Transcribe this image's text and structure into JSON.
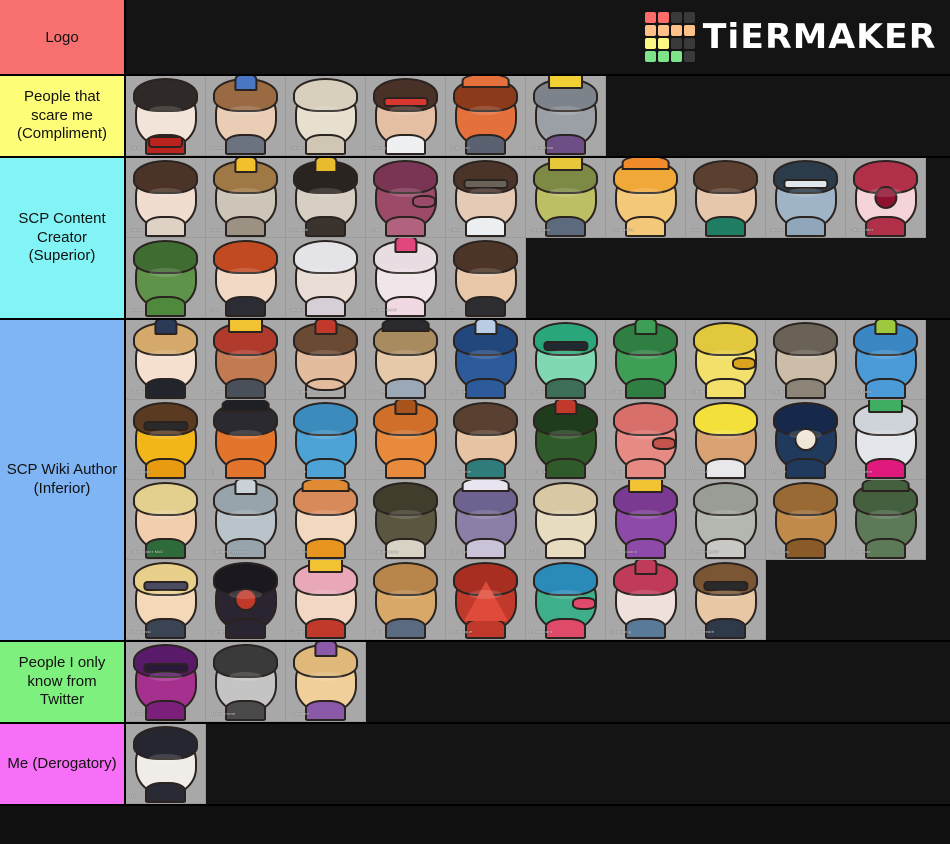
{
  "header": {
    "logo_label": "Logo",
    "brand_name": "TiERMAKER",
    "brand_colors": {
      "red": "#ff6b6b",
      "orange": "#ffc089",
      "yellow": "#fbf783",
      "green": "#7fe38a",
      "empty": "#3a3a3a"
    },
    "logo_grid": [
      [
        "red",
        "red",
        "empty",
        "empty"
      ],
      [
        "orange",
        "orange",
        "orange",
        "orange"
      ],
      [
        "yellow",
        "yellow",
        "empty",
        "empty"
      ],
      [
        "green",
        "green",
        "green",
        "empty"
      ]
    ]
  },
  "tiers": [
    {
      "label": "People that scare me (Compliment)",
      "color": "#fdfd77",
      "rows": [
        [
          {
            "name": "pale-clown-face-avatar",
            "wm": "Asriel",
            "skin": "#f2e4d9",
            "hair": "#2f2a28",
            "acc": "#b9241f",
            "body": "#b9241f",
            "acc_kind": "bowtie"
          },
          {
            "name": "curly-hair-goggles-avatar",
            "wm": "Anaxes",
            "skin": "#e9cdb4",
            "hair": "#9a6b42",
            "acc": "#4a77c4",
            "body": "#6b7280",
            "acc_kind": "goggles"
          },
          {
            "name": "skull-avatar",
            "wm": "Smapti",
            "skin": "#e8e0cf",
            "hair": "#d8cfbc",
            "acc": "#e8e0cf",
            "body": "#cfc6b3",
            "acc_kind": "none"
          },
          {
            "name": "red-glasses-man-avatar",
            "wm": "Tanhony",
            "skin": "#e5bfa3",
            "hair": "#4a3127",
            "acc": "#d8372f",
            "body": "#eef0f2",
            "acc_kind": "glasses"
          },
          {
            "name": "red-demon-avatar",
            "wm": "Ogre Lord",
            "skin": "#e4703c",
            "hair": "#8c3a1c",
            "acc": "#e4703c",
            "body": "#5a6170",
            "acc_kind": "horns"
          },
          {
            "name": "yellow-cap-man-avatar",
            "wm": "Grand Rose",
            "skin": "#9aa0a6",
            "hair": "#7d838a",
            "acc": "#f3cf36",
            "body": "#6e4e86",
            "acc_kind": "cap"
          }
        ]
      ]
    },
    {
      "label": "SCP Content Creator (Superior)",
      "color": "#82f4f6",
      "rows": [
        [
          {
            "name": "long-dark-hair-avatar",
            "wm": "Wookily",
            "skin": "#f0ddd0",
            "hair": "#4b3427",
            "acc": "#4b3427",
            "body": "#ded2c4",
            "acc_kind": "none"
          },
          {
            "name": "yellow-flower-hair-avatar",
            "wm": "Cillan",
            "skin": "#cdc6b8",
            "hair": "#a07845",
            "acc": "#f2c02d",
            "body": "#9c9284",
            "acc_kind": "flower"
          },
          {
            "name": "gold-mask-avatar",
            "wm": "Decibelle",
            "skin": "#d8cfc4",
            "hair": "#2a2420",
            "acc": "#e7bb2c",
            "body": "#3a332e",
            "acc_kind": "flower"
          },
          {
            "name": "purple-dragon-avatar",
            "wm": "Grim",
            "skin": "#9c4a6a",
            "hair": "#7b3554",
            "acc": "#9c4a6a",
            "body": "#b0627f",
            "acc_kind": "snout"
          },
          {
            "name": "glasses-lab-coat-avatar",
            "wm": "Elena",
            "skin": "#e5cbb6",
            "hair": "#4a342a",
            "acc": "#6a6258",
            "body": "#eceff2",
            "acc_kind": "glasses"
          },
          {
            "name": "crowned-frog-avatar",
            "wm": "Frogdonia",
            "skin": "#bcbf64",
            "hair": "#7d8a45",
            "acc": "#e7c83a",
            "body": "#5d6a7e",
            "acc_kind": "crown"
          },
          {
            "name": "orange-rabbit-avatar",
            "wm": "Lil Sunshine",
            "skin": "#f3c878",
            "hair": "#f0a838",
            "acc": "#f08a2a",
            "body": "#f3c878",
            "acc_kind": "ears"
          },
          {
            "name": "brown-hair-green-shirt-avatar",
            "wm": "Locky",
            "skin": "#e7c7ac",
            "hair": "#5b4030",
            "acc": "#5b4030",
            "body": "#1f7d63",
            "acc_kind": "none"
          },
          {
            "name": "blue-tinted-glasses-man-avatar",
            "wm": "Naveria",
            "skin": "#9fb4c6",
            "hair": "#2c3b4a",
            "acc": "#dfe6ec",
            "body": "#8fa6bb",
            "acc_kind": "glasses"
          },
          {
            "name": "eyeball-avatar",
            "wm": "Placeholder",
            "skin": "#f4d4d8",
            "hair": "#b0304a",
            "acc": "#8e1230",
            "body": "#b0304a",
            "acc_kind": "eye"
          }
        ],
        [
          {
            "name": "green-alien-bust-avatar",
            "wm": "Mortos",
            "skin": "#5f9349",
            "hair": "#3f6c30",
            "acc": "#5f9349",
            "body": "#4f8a3c",
            "acc_kind": "none"
          },
          {
            "name": "red-hair-girl-avatar",
            "wm": "Ellie",
            "skin": "#f2d9c6",
            "hair": "#c14a22",
            "acc": "#e3e7ea",
            "body": "#2c2c34",
            "acc_kind": "none"
          },
          {
            "name": "white-hair-girl-avatar",
            "wm": "Nagiros",
            "skin": "#e9ddd6",
            "hair": "#e3e3e8",
            "acc": "#6e5a7a",
            "body": "#d6cfd8",
            "acc_kind": "none"
          },
          {
            "name": "microphone-podcast-avatar",
            "wm": "Sounds Good",
            "skin": "#f0e6ea",
            "hair": "#e8dde2",
            "acc": "#e0467c",
            "body": "#f0d9e2",
            "acc_kind": "mic"
          },
          {
            "name": "curly-brown-hair-avatar",
            "wm": "Zyn",
            "skin": "#e9c8aa",
            "hair": "#4c3526",
            "acc": "#4c3526",
            "body": "#2e2e32",
            "acc_kind": "none"
          }
        ]
      ]
    },
    {
      "label": "SCP Wiki Author (Inferior)",
      "color": "#7fb5f5",
      "rows": [
        [
          {
            "name": "blonde-curls-bow-avatar",
            "wm": "Arakiel",
            "skin": "#f6e0d0",
            "hair": "#d4a96a",
            "acc": "#2b3a57",
            "body": "#22252c",
            "acc_kind": "bow"
          },
          {
            "name": "crowned-clay-head-avatar",
            "wm": "Ayers",
            "skin": "#c27a52",
            "hair": "#b03a2c",
            "acc": "#f1c232",
            "body": "#4a5059",
            "acc_kind": "crown"
          },
          {
            "name": "bearded-man-avatar",
            "wm": "Croquembouche",
            "skin": "#e2bc9d",
            "hair": "#6b4a33",
            "acc": "#c0392b",
            "body": "#e9ece f",
            "acc_kind": "beard"
          },
          {
            "name": "masked-hoodie-avatar",
            "wm": "Dr Grey",
            "skin": "#e6c9a8",
            "hair": "#a88b5f",
            "acc": "#2a2a2f",
            "body": "#9aa9b5",
            "acc_kind": "horns"
          },
          {
            "name": "blue-whale-avatar",
            "wm": "Ecronak",
            "skin": "#2d5a9b",
            "hair": "#21477d",
            "acc": "#b8cde4",
            "body": "#2d5a9b",
            "acc_kind": "whale"
          },
          {
            "name": "green-hair-sunglasses-avatar",
            "wm": "Estrella",
            "skin": "#7fd8b1",
            "hair": "#2aa77a",
            "acc": "#1f2a33",
            "body": "#3c6e58",
            "acc_kind": "glasses"
          },
          {
            "name": "cactus-avatar",
            "wm": "Fishish",
            "skin": "#3f9e55",
            "hair": "#2f7f43",
            "acc": "#3f9e55",
            "body": "#2f7f43",
            "acc_kind": "cactus"
          },
          {
            "name": "yellow-bird-avatar",
            "wm": "Gabriel",
            "skin": "#f2e06a",
            "hair": "#e2c83c",
            "acc": "#dba41f",
            "body": "#f2e06a",
            "acc_kind": "beak"
          },
          {
            "name": "raccoon-avatar",
            "wm": "Grigori",
            "skin": "#cbbda8",
            "hair": "#6b6257",
            "acc": "#3a3530",
            "body": "#8d8478",
            "acc_kind": "none"
          },
          {
            "name": "blue-flower-eye-avatar",
            "wm": "HarryBlank",
            "skin": "#4a9bd8",
            "hair": "#3a87c4",
            "acc": "#9ec93f",
            "body": "#4a9bd8",
            "acc_kind": "flower"
          }
        ],
        [
          {
            "name": "yellow-face-glasses-avatar",
            "wm": "Jakdragonx",
            "skin": "#f3b619",
            "hair": "#5a3a20",
            "acc": "#2a2a2a",
            "body": "#e89a10",
            "acc_kind": "glasses"
          },
          {
            "name": "orange-crab-avatar",
            "wm": "Ihp",
            "skin": "#e2742c",
            "hair": "#2a2a30",
            "acc": "#1f2026",
            "body": "#e2742c",
            "acc_kind": "horns"
          },
          {
            "name": "blue-slime-avatar",
            "wm": "Jack Ike",
            "skin": "#4da3d6",
            "hair": "#3b8bbd",
            "acc": "#2a2a30",
            "body": "#4da3d6",
            "acc_kind": "none"
          },
          {
            "name": "orange-octopus-avatar",
            "wm": "Kaktus",
            "skin": "#e78a3c",
            "hair": "#cf6f2a",
            "acc": "#a8521c",
            "body": "#e78a3c",
            "acc_kind": "tentacles"
          },
          {
            "name": "brown-hair-teal-collar-avatar",
            "wm": "Ladyflibble",
            "skin": "#e6c3a2",
            "hair": "#5a4030",
            "acc": "#5a4030",
            "body": "#2e7d7a",
            "acc_kind": "none"
          },
          {
            "name": "red-flower-stalk-avatar",
            "wm": "Lt Flops",
            "skin": "#2f5a2a",
            "hair": "#1f3d1c",
            "acc": "#c0392b",
            "body": "#2f5a2a",
            "acc_kind": "flower"
          },
          {
            "name": "pig-avatar",
            "wm": "Lyrian",
            "skin": "#e88a84",
            "hair": "#d96f6a",
            "acc": "#c4534e",
            "body": "#e88a84",
            "acc_kind": "snout"
          },
          {
            "name": "blonde-girl-open-mouth-avatar",
            "wm": "MaliceAF",
            "skin": "#d9a273",
            "hair": "#f3e03a",
            "acc": "#f0f0f0",
            "body": "#e8e8ea",
            "acc_kind": "none"
          },
          {
            "name": "dark-blue-blob-eyes-avatar",
            "wm": "Mew-ike",
            "skin": "#203a5e",
            "hair": "#16294a",
            "acc": "#f0e6d8",
            "body": "#203a5e",
            "acc_kind": "eye"
          },
          {
            "name": "green-witch-hat-avatar",
            "wm": "NDHeckfire",
            "skin": "#e3e6ea",
            "hair": "#cfd4da",
            "acc": "#3fae62",
            "body": "#e0197d",
            "acc_kind": "hat"
          }
        ],
        [
          {
            "name": "blonde-green-shirt-avatar",
            "wm": "Placeholder McD",
            "skin": "#f1cfae",
            "hair": "#e3cf8e",
            "acc": "#4a3a22",
            "body": "#2e6b3a",
            "acc_kind": "none"
          },
          {
            "name": "hooded-grey-figure-avatar",
            "wm": "Quantum Physician",
            "skin": "#b9c4ca",
            "hair": "#98a4ab",
            "acc": "#c8d2d8",
            "body": "#98a4ab",
            "acc_kind": "hood"
          },
          {
            "name": "cat-ear-hoodie-girl-avatar",
            "wm": "Ralliston",
            "skin": "#f3d8c0",
            "hair": "#d98a5a",
            "acc": "#e08a33",
            "body": "#e8951f",
            "acc_kind": "ears"
          },
          {
            "name": "dark-fish-creature-avatar",
            "wm": "Rounderhouse",
            "skin": "#5a5640",
            "hair": "#403d2c",
            "acc": "#2a2820",
            "body": "#d7d2c4",
            "acc_kind": "none"
          },
          {
            "name": "purple-bat-creature-avatar",
            "wm": "SciSarge",
            "skin": "#8b7fa8",
            "hair": "#6e6390",
            "acc": "#e8e4f0",
            "body": "#c9c2d8",
            "acc_kind": "ears"
          },
          {
            "name": "fool-text-avatar",
            "wm": "Tufto",
            "skin": "#e8dcc0",
            "hair": "#d8c9a4",
            "acc": "#b8a57c",
            "body": "#e8dcc0",
            "acc_kind": "none"
          },
          {
            "name": "purple-blob-crown-avatar",
            "wm": "Uncle Nicolini",
            "skin": "#8e4aa8",
            "hair": "#7a3a92",
            "acc": "#f1c232",
            "body": "#8e4aa8",
            "acc_kind": "crown"
          },
          {
            "name": "grey-seal-avatar",
            "wm": "Veiedhimaedhr",
            "skin": "#b4b6b0",
            "hair": "#9a9c96",
            "acc": "#e8e8e8",
            "body": "#c8c9c4",
            "acc_kind": "none"
          },
          {
            "name": "dog-with-sign-avatar",
            "wm": "Good Boy",
            "skin": "#c08a4a",
            "hair": "#9a6a34",
            "acc": "#e8d6b8",
            "body": "#8a5a28",
            "acc_kind": "none"
          },
          {
            "name": "green-antler-creature-avatar",
            "wm": "Woedenaz",
            "skin": "#5d7a58",
            "hair": "#45603f",
            "acc": "#45603f",
            "body": "#5d7a58",
            "acc_kind": "horns"
          }
        ],
        [
          {
            "name": "blonde-sunglasses-avatar",
            "wm": "Yossipossi",
            "skin": "#f3d9b8",
            "hair": "#e8cf8a",
            "acc": "#4a4a60",
            "body": "#3a4452",
            "acc_kind": "glasses"
          },
          {
            "name": "dark-red-eyes-creature-avatar",
            "wm": "Zhange",
            "skin": "#2a2530",
            "hair": "#1c1820",
            "acc": "#c0392b",
            "body": "#2a2530",
            "acc_kind": "eye"
          },
          {
            "name": "yellow-hat-pink-scarf-avatar",
            "wm": "Zynetic",
            "skin": "#f2d8c4",
            "hair": "#e8a8b8",
            "acc": "#f1c232",
            "body": "#c0392b",
            "acc_kind": "hat"
          },
          {
            "name": "muffin-avatar",
            "wm": "Muffin",
            "skin": "#d8a868",
            "hair": "#b8854a",
            "acc": "#8a9ab0",
            "body": "#5a6a80",
            "acc_kind": "none"
          },
          {
            "name": "red-triangle-avatar",
            "wm": "Pedantique",
            "skin": "#c0392b",
            "hair": "#a82e22",
            "acc": "#e04a3a",
            "body": "#c0392b",
            "acc_kind": "triangle"
          },
          {
            "name": "rainbow-bird-avatar",
            "wm": "Prismshard",
            "skin": "#3fae8a",
            "hair": "#2a8ab8",
            "acc": "#e04a6a",
            "body": "#e04a6a",
            "acc_kind": "beak"
          },
          {
            "name": "axolotl-avatar",
            "wm": "Sirpudding",
            "skin": "#f0e0dc",
            "hair": "#c03a5a",
            "acc": "#c03a5a",
            "body": "#5a7a9a",
            "acc_kind": "frills"
          },
          {
            "name": "long-brown-hair-glasses-avatar",
            "wm": "Stormbreath",
            "skin": "#e8c8a4",
            "hair": "#7a5634",
            "acc": "#2a2a2a",
            "body": "#2e3a4a",
            "acc_kind": "glasses"
          }
        ]
      ]
    },
    {
      "label": "People I only know from Twitter",
      "color": "#7ef07e",
      "rows": [
        [
          {
            "name": "glitch-pink-mask-avatar",
            "wm": "Glitchy",
            "skin": "#a6308e",
            "hair": "#5a1a6a",
            "acc": "#2a1a3a",
            "body": "#7a1f7a",
            "acc_kind": "glasses"
          },
          {
            "name": "greyscale-suit-man-avatar",
            "wm": "Monochrome",
            "skin": "#c4c4c4",
            "hair": "#3a3a3a",
            "acc": "#2a2a2a",
            "body": "#4a4a4a",
            "acc_kind": "none"
          },
          {
            "name": "tan-octopus-avatar",
            "wm": "Tentacled",
            "skin": "#f0cf9a",
            "hair": "#e0b87a",
            "acc": "#8a5aa8",
            "body": "#8a5aa8",
            "acc_kind": "tentacles"
          }
        ]
      ]
    },
    {
      "label": "Me (Derogatory)",
      "color": "#f76ef7",
      "rows": [
        [
          {
            "name": "pale-face-dark-hair-avatar",
            "wm": "Me",
            "skin": "#f0ece8",
            "hair": "#262630",
            "acc": "#262630",
            "body": "#2a2a34",
            "acc_kind": "none"
          }
        ]
      ]
    }
  ]
}
